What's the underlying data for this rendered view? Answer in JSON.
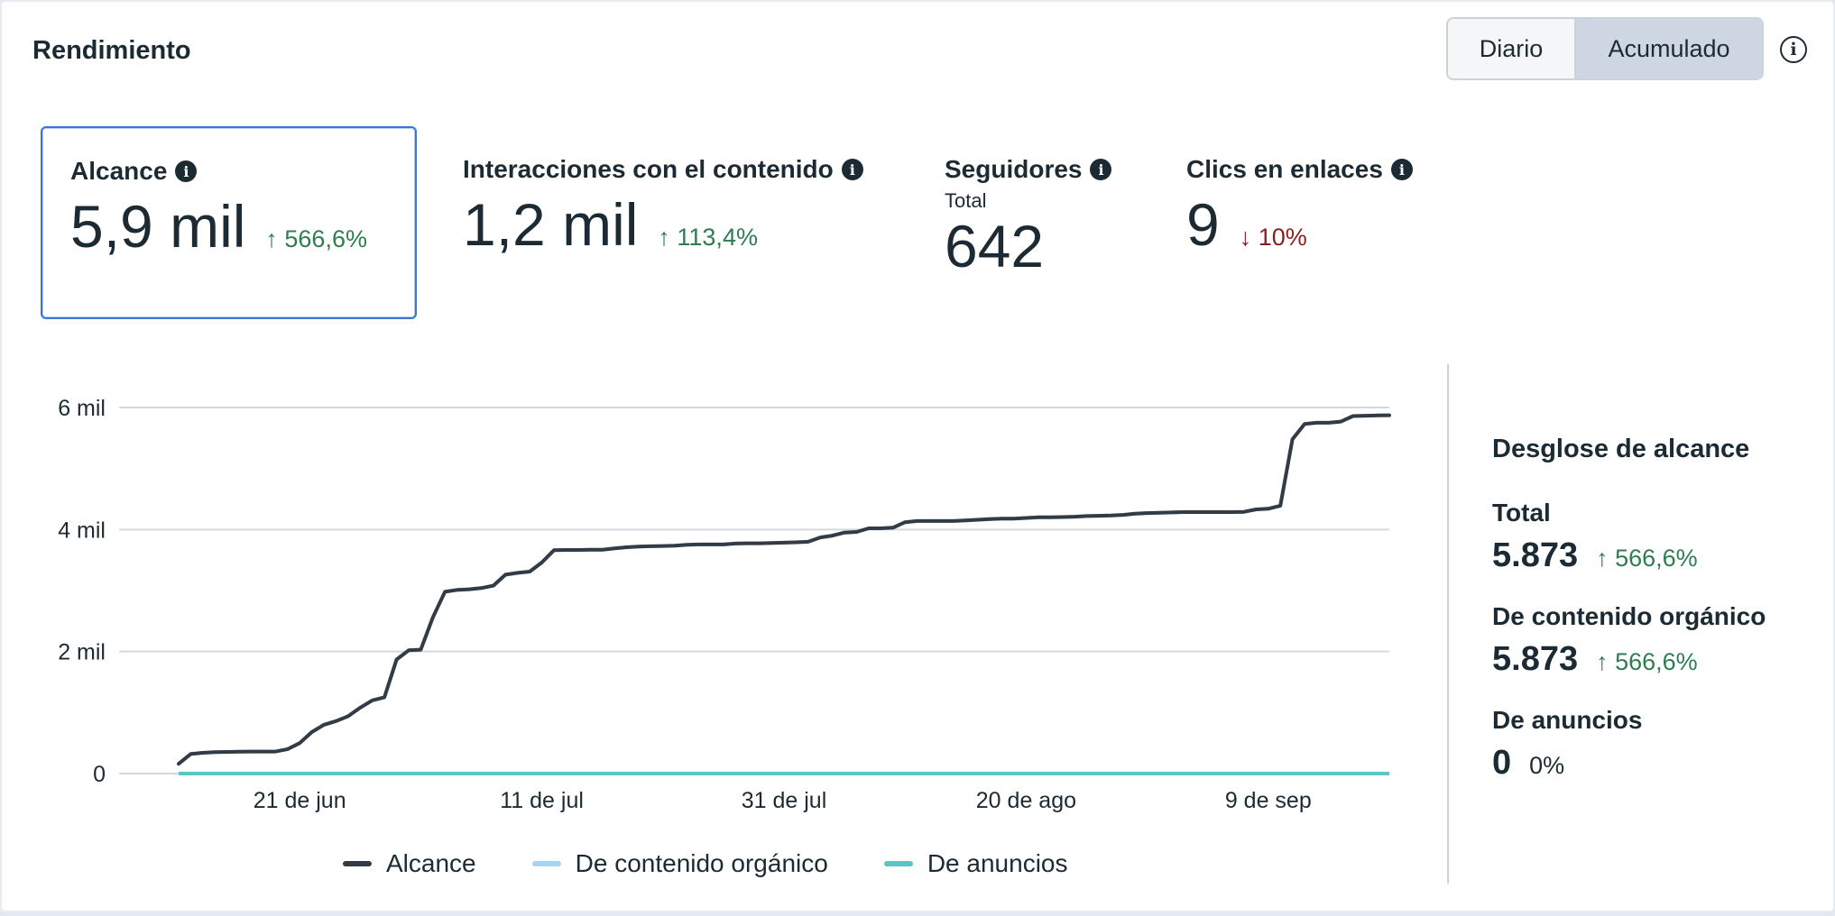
{
  "header": {
    "title": "Rendimiento",
    "info_icon": "info-icon"
  },
  "toggle": {
    "options": [
      "Diario",
      "Acumulado"
    ],
    "selected": "Acumulado"
  },
  "metrics": [
    {
      "label": "Alcance",
      "value": "5,9 mil",
      "change": "↑ 566,6%",
      "trend": "up",
      "selected": true
    },
    {
      "label": "Interacciones con el contenido",
      "value": "1,2 mil",
      "change": "↑ 113,4%",
      "trend": "up"
    },
    {
      "label": "Seguidores",
      "sublabel": "Total",
      "value": "642"
    },
    {
      "label": "Clics en enlaces",
      "value": "9",
      "change": "↓ 10%",
      "trend": "down"
    }
  ],
  "colors": {
    "alcance": "#333b44",
    "organico": "#a6d4f5",
    "anuncios": "#5bc4c4",
    "up": "#2e7d50",
    "down": "#8a1f1f",
    "selected_border": "#3a78d0"
  },
  "chart_data": {
    "type": "line",
    "y_ticks": [
      "0",
      "2 mil",
      "4 mil",
      "6 mil"
    ],
    "ylim": [
      0,
      6000
    ],
    "x_tick_labels": [
      "21 de jun",
      "11 de jul",
      "31 de jul",
      "20 de ago",
      "9 de sep"
    ],
    "x_tick_dates": [
      "2025-06-21",
      "2025-07-11",
      "2025-07-31",
      "2025-08-20",
      "2025-09-09"
    ],
    "grid": true,
    "legend_position": "bottom",
    "series": [
      {
        "name": "Alcance",
        "x": [
          "2025-06-11",
          "2025-06-12",
          "2025-06-13",
          "2025-06-14",
          "2025-06-15",
          "2025-06-16",
          "2025-06-17",
          "2025-06-18",
          "2025-06-19",
          "2025-06-20",
          "2025-06-21",
          "2025-06-22",
          "2025-06-23",
          "2025-06-24",
          "2025-06-25",
          "2025-06-26",
          "2025-06-27",
          "2025-06-28",
          "2025-06-29",
          "2025-06-30",
          "2025-07-01",
          "2025-07-02",
          "2025-07-03",
          "2025-07-04",
          "2025-07-05",
          "2025-07-06",
          "2025-07-07",
          "2025-07-08",
          "2025-07-09",
          "2025-07-10",
          "2025-07-11",
          "2025-07-12",
          "2025-07-13",
          "2025-07-14",
          "2025-07-15",
          "2025-07-16",
          "2025-07-17",
          "2025-07-18",
          "2025-07-19",
          "2025-07-20",
          "2025-07-21",
          "2025-07-22",
          "2025-07-23",
          "2025-07-24",
          "2025-07-25",
          "2025-07-26",
          "2025-07-27",
          "2025-07-28",
          "2025-07-29",
          "2025-07-30",
          "2025-07-31",
          "2025-08-01",
          "2025-08-02",
          "2025-08-03",
          "2025-08-04",
          "2025-08-05",
          "2025-08-06",
          "2025-08-07",
          "2025-08-08",
          "2025-08-09",
          "2025-08-10",
          "2025-08-11",
          "2025-08-12",
          "2025-08-13",
          "2025-08-14",
          "2025-08-15",
          "2025-08-16",
          "2025-08-17",
          "2025-08-18",
          "2025-08-19",
          "2025-08-20",
          "2025-08-21",
          "2025-08-22",
          "2025-08-23",
          "2025-08-24",
          "2025-08-25",
          "2025-08-26",
          "2025-08-27",
          "2025-08-28",
          "2025-08-29",
          "2025-08-30",
          "2025-08-31",
          "2025-09-01",
          "2025-09-02",
          "2025-09-03",
          "2025-09-04",
          "2025-09-05",
          "2025-09-06",
          "2025-09-07",
          "2025-09-08",
          "2025-09-09",
          "2025-09-10",
          "2025-09-11",
          "2025-09-12",
          "2025-09-13",
          "2025-09-14",
          "2025-09-15",
          "2025-09-16",
          "2025-09-17",
          "2025-09-18",
          "2025-09-19"
        ],
        "y": [
          160,
          320,
          340,
          350,
          355,
          358,
          360,
          360,
          360,
          400,
          500,
          680,
          800,
          860,
          940,
          1080,
          1200,
          1250,
          1870,
          2020,
          2030,
          2560,
          2980,
          3010,
          3020,
          3040,
          3080,
          3260,
          3290,
          3310,
          3460,
          3660,
          3665,
          3665,
          3670,
          3670,
          3690,
          3710,
          3720,
          3725,
          3730,
          3735,
          3750,
          3755,
          3755,
          3755,
          3770,
          3775,
          3775,
          3780,
          3785,
          3790,
          3800,
          3870,
          3900,
          3950,
          3960,
          4020,
          4020,
          4030,
          4120,
          4140,
          4140,
          4140,
          4140,
          4150,
          4160,
          4170,
          4180,
          4180,
          4190,
          4200,
          4200,
          4205,
          4210,
          4220,
          4225,
          4230,
          4240,
          4260,
          4270,
          4275,
          4280,
          4285,
          4285,
          4285,
          4285,
          4285,
          4290,
          4330,
          4340,
          4390,
          5480,
          5730,
          5750,
          5750,
          5770,
          5860,
          5865,
          5870,
          5873
        ]
      },
      {
        "name": "De contenido orgánico",
        "values": "same as Alcance"
      },
      {
        "name": "De anuncios",
        "x_range": [
          "2025-06-11",
          "2025-09-19"
        ],
        "value": 0
      }
    ]
  },
  "legend": [
    "Alcance",
    "De contenido orgánico",
    "De anuncios"
  ],
  "breakdown": {
    "title": "Desglose de alcance",
    "items": [
      {
        "label": "Total",
        "value": "5.873",
        "change": "↑ 566,6%",
        "trend": "up"
      },
      {
        "label": "De contenido orgánico",
        "value": "5.873",
        "change": "↑ 566,6%",
        "trend": "up"
      },
      {
        "label": "De anuncios",
        "value": "0",
        "change": "0%",
        "trend": "neutral"
      }
    ]
  }
}
